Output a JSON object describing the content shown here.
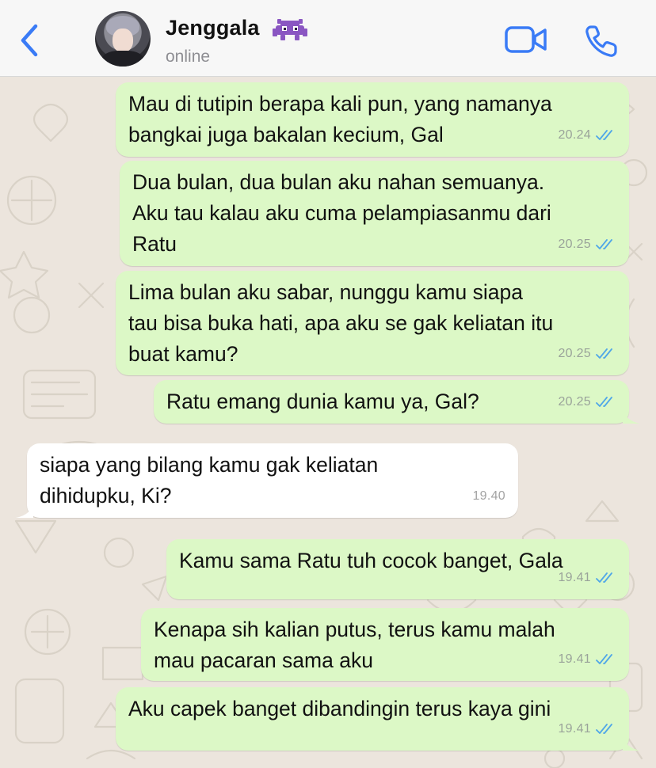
{
  "header": {
    "contact_name": "Jenggala",
    "contact_emoji": "alien-monster",
    "status": "online",
    "back_icon": "chevron-left-icon",
    "video_icon": "video-camera-icon",
    "call_icon": "phone-icon"
  },
  "colors": {
    "accent": "#3a7bf6",
    "outgoing_bubble": "#dcf8c6",
    "incoming_bubble": "#ffffff",
    "read_tick": "#4fa6e8",
    "chat_background": "#ece5dd"
  },
  "messages": [
    {
      "direction": "out",
      "text": "Mau di tutipin berapa kali pun, yang namanya\nbangkai juga bakalan kecium, Gal",
      "time": "20.24",
      "status": "read"
    },
    {
      "direction": "out",
      "text": "Dua bulan, dua bulan aku nahan semuanya.\nAku tau kalau aku cuma pelampiasanmu dari\nRatu",
      "time": "20.25",
      "status": "read"
    },
    {
      "direction": "out",
      "text": "Lima bulan aku sabar, nunggu kamu siapa\ntau bisa buka hati, apa aku se gak keliatan itu\nbuat kamu?",
      "time": "20.25",
      "status": "read"
    },
    {
      "direction": "out",
      "text": "Ratu emang dunia kamu ya, Gal?",
      "time": "20.25",
      "status": "read"
    },
    {
      "direction": "in",
      "text": "siapa yang bilang kamu gak keliatan\ndihidupku, Ki?",
      "time": "19.40"
    },
    {
      "direction": "out",
      "text": "Kamu sama Ratu tuh cocok banget, Gala",
      "time": "19.41",
      "status": "read"
    },
    {
      "direction": "out",
      "text": "Kenapa sih kalian putus, terus kamu malah\nmau pacaran sama aku",
      "time": "19.41",
      "status": "read"
    },
    {
      "direction": "out",
      "text": "Aku capek banget dibandingin terus kaya gini",
      "time": "19.41",
      "status": "read"
    }
  ]
}
